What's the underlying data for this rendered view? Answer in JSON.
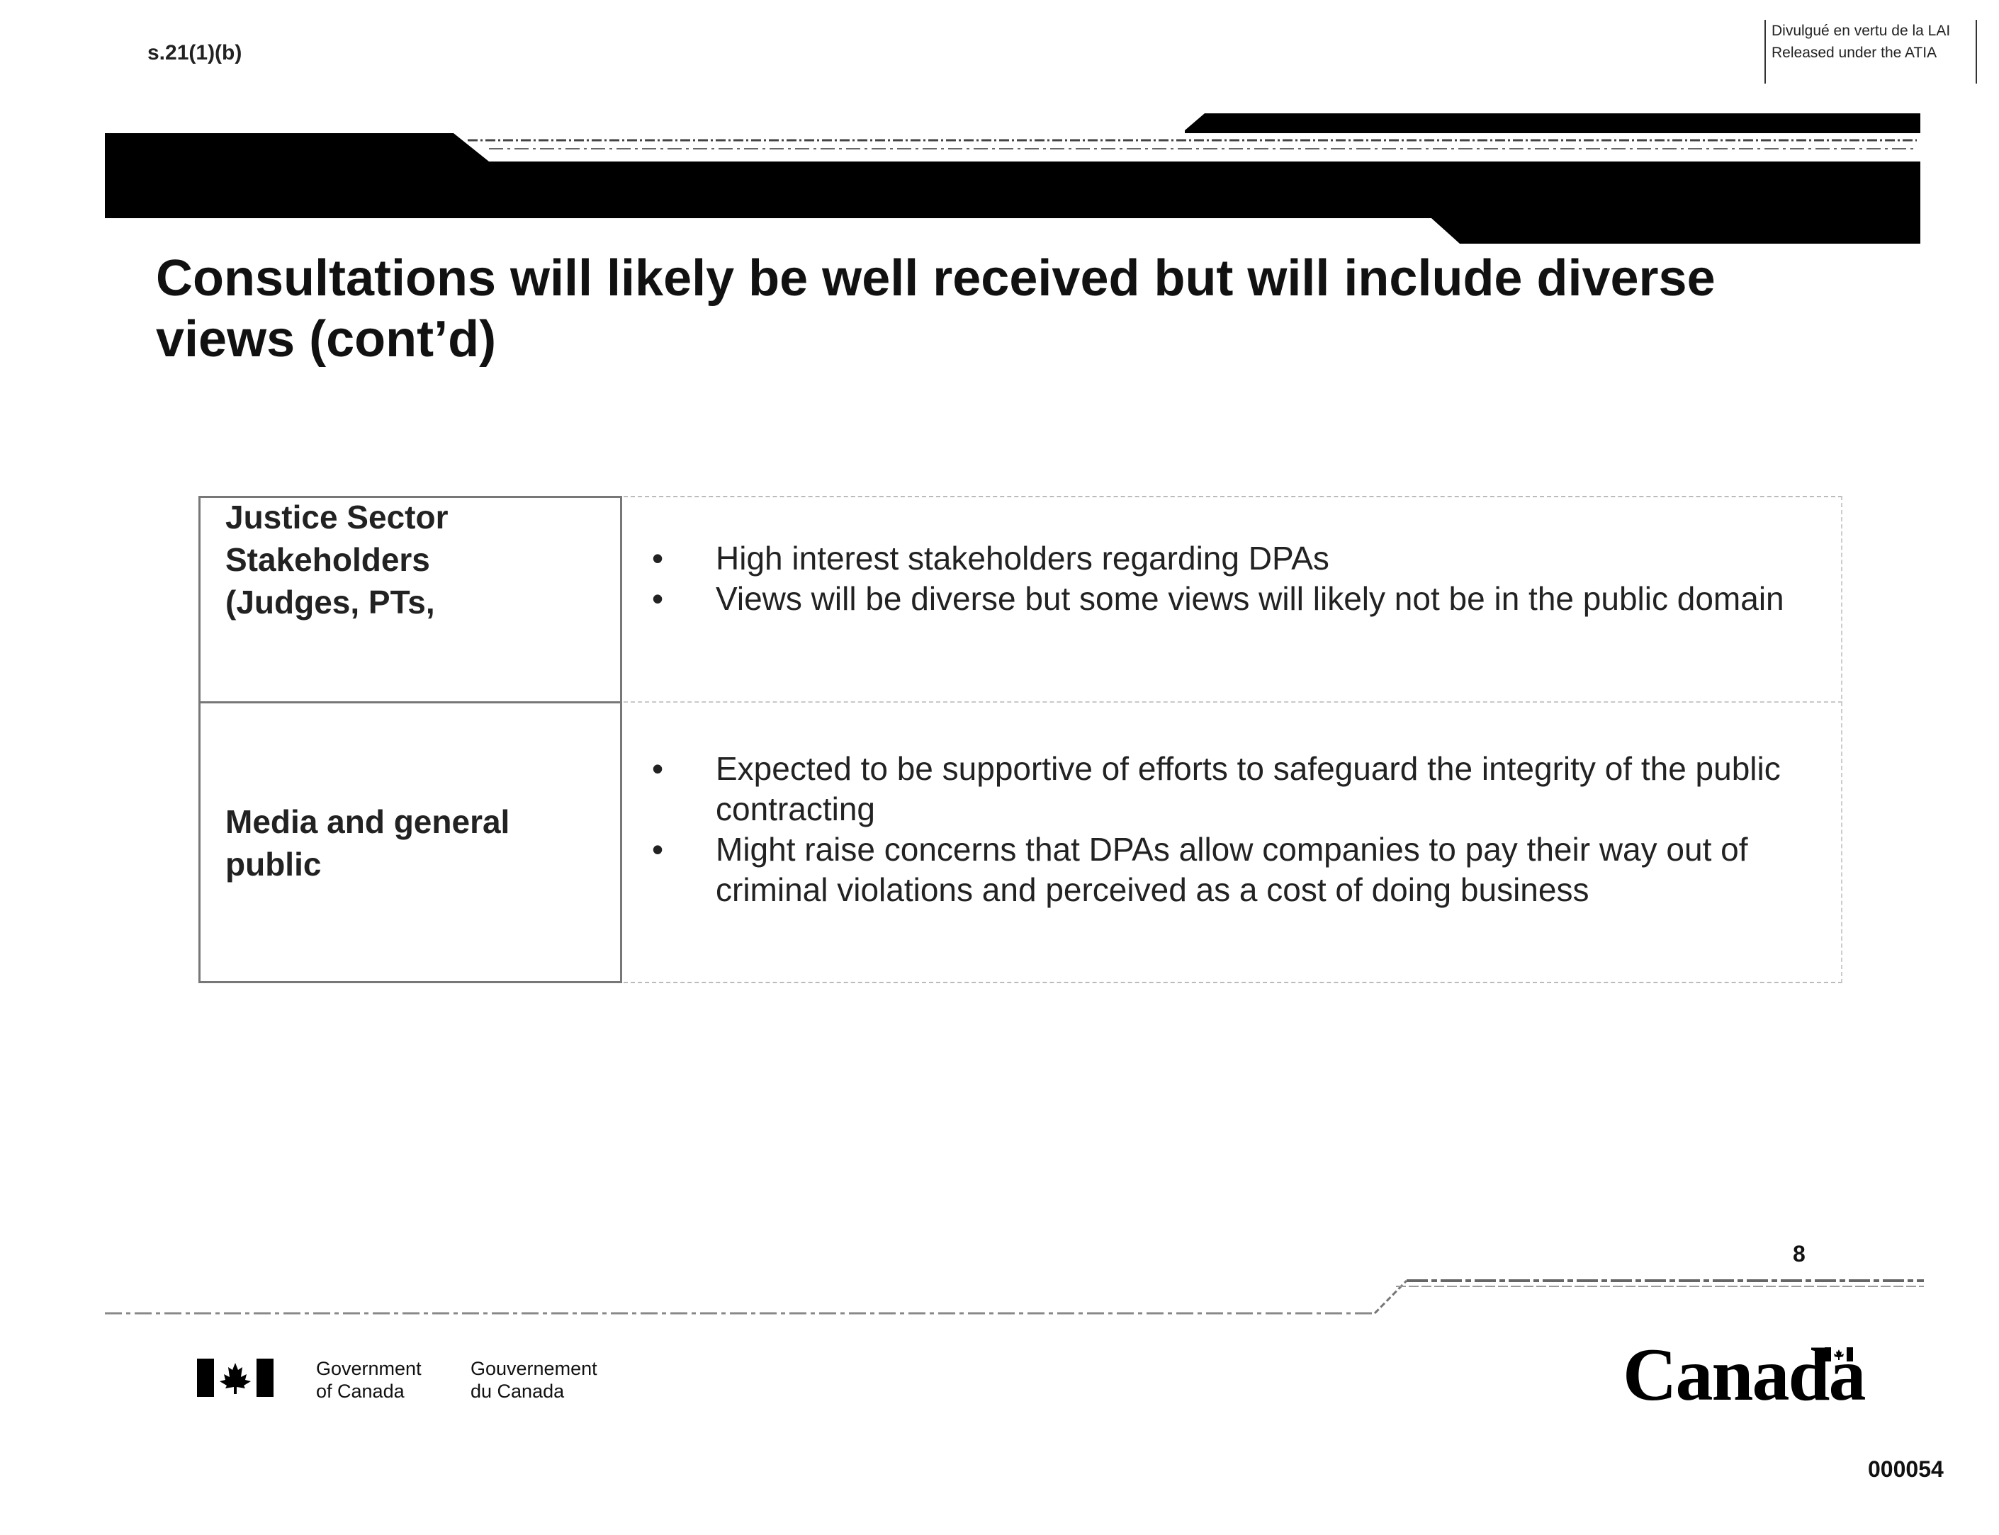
{
  "exemption_code": "s.21(1)(b)",
  "release_stamp": {
    "line_fr": "Divulgué en vertu de la LAI",
    "line_en": "Released under the ATIA"
  },
  "slide": {
    "title_line1": "Consultations will likely be well received but will include diverse",
    "title_line2": "views (cont’d)",
    "rows": [
      {
        "label_lines": [
          "Justice Sector",
          "Stakeholders",
          "(Judges, PTs,"
        ],
        "bullets": [
          "High interest stakeholders regarding DPAs",
          "Views will be diverse but some views will likely not be in the public domain"
        ]
      },
      {
        "label_lines": [
          "Media and general",
          "public"
        ],
        "bullets": [
          "Expected to be supportive of efforts to safeguard the integrity of the public contracting",
          "Might raise concerns that DPAs allow companies to pay their way out of criminal violations and perceived as a cost of doing business"
        ]
      }
    ],
    "page_number": "8"
  },
  "footer": {
    "gov_en_line1": "Government",
    "gov_en_line2": "of Canada",
    "gov_fr_line1": "Gouvernement",
    "gov_fr_line2": "du Canada",
    "canada_wordmark": "Canada",
    "document_number": "000054"
  },
  "colors": {
    "banner": "#000000",
    "text": "#1a1a1a",
    "flag_red": "#000000"
  }
}
